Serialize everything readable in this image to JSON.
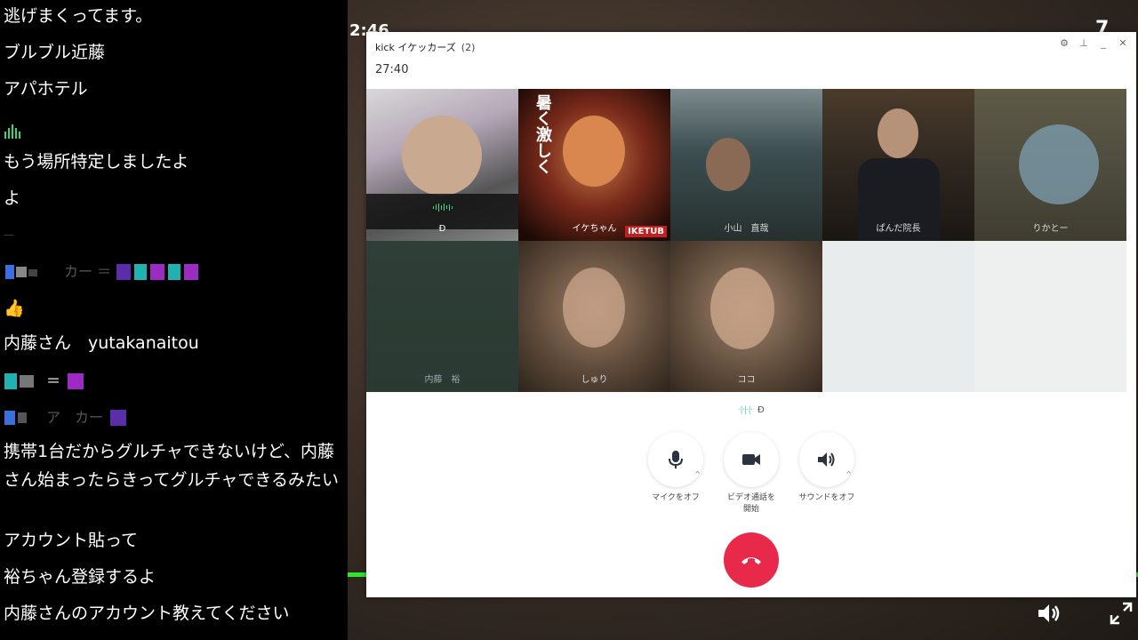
{
  "chat": {
    "messages": [
      {
        "text": "逃げまくってます。"
      },
      {
        "text": "ブルブル近藤"
      },
      {
        "text": "アパホテル"
      },
      {
        "text": ""
      },
      {
        "text": "もう場所特定しましたよ"
      },
      {
        "text": "よ"
      },
      {
        "text": "—"
      },
      {
        "text": "カー ＝"
      },
      {
        "text": "👍"
      },
      {
        "text": "内藤さん　yutakanaitou"
      },
      {
        "text": "＝"
      },
      {
        "text": "ア　カー"
      },
      {
        "text": "携帯1台だからグルチャできないけど、内藤さん始まったらきってグルチャできるみたい"
      },
      {
        "text": "アカウント貼って"
      },
      {
        "text": "裕ちゃん登録するよ"
      },
      {
        "text": "内藤さんのアカウント教えてください"
      }
    ]
  },
  "stream": {
    "clock": "2:46",
    "logo": "7"
  },
  "call": {
    "app": "kick イケッカーズ",
    "member_count": "(2)",
    "timer": "27:40",
    "participants": [
      {
        "name": "Ð"
      },
      {
        "name": "イケちゃん"
      },
      {
        "name": "小山　直哉"
      },
      {
        "name": "ぱんだ院長"
      },
      {
        "name": "りかとー"
      },
      {
        "name": "内藤　裕"
      },
      {
        "name": "しゅり"
      },
      {
        "name": "ココ"
      }
    ],
    "tile1_banner": "暑く激しく",
    "tile1_logo": "IKETUB",
    "active_speaker": "Ð",
    "controls": {
      "mic_label": "マイクをオフ",
      "video_label_1": "ビデオ通話を",
      "video_label_2": "開始",
      "sound_label": "サウンドをオフ"
    }
  },
  "colors": {
    "hangup": "#e8294a",
    "speaking": "#3fd88a",
    "progress": "#2ee62e"
  }
}
